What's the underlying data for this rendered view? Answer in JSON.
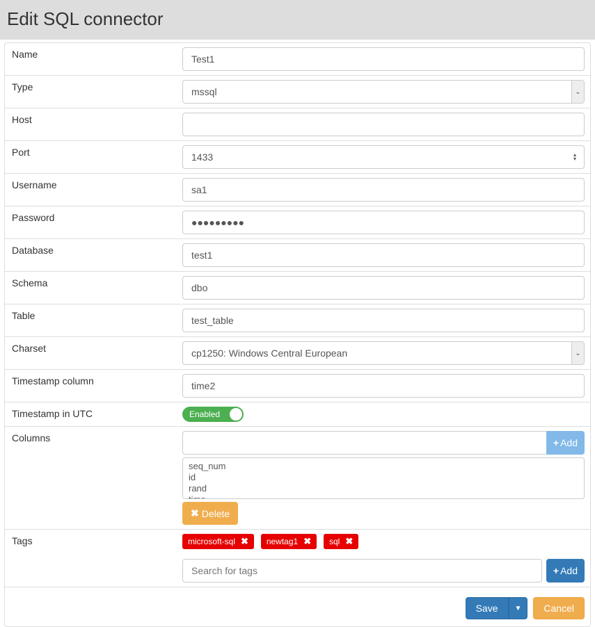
{
  "header": {
    "title": "Edit SQL connector"
  },
  "labels": {
    "name": "Name",
    "type": "Type",
    "host": "Host",
    "port": "Port",
    "username": "Username",
    "password": "Password",
    "database": "Database",
    "schema": "Schema",
    "table": "Table",
    "charset": "Charset",
    "timestamp_column": "Timestamp column",
    "timestamp_utc": "Timestamp in UTC",
    "columns": "Columns",
    "tags": "Tags"
  },
  "values": {
    "name": "Test1",
    "type": "mssql",
    "host": "",
    "port": "1433",
    "username": "sa1",
    "password": "●●●●●●●●●",
    "database": "test1",
    "schema": "dbo",
    "table": "test_table",
    "charset": "cp1250: Windows Central European",
    "timestamp_column": "time2",
    "timestamp_utc_label": "Enabled"
  },
  "columns": {
    "add_label": "Add",
    "delete_label": "Delete",
    "items": [
      "seq_num",
      "id",
      "rand",
      "time"
    ]
  },
  "tags": {
    "items": [
      "microsoft-sql",
      "newtag1",
      "sql"
    ],
    "search_placeholder": "Search for tags",
    "add_label": "Add"
  },
  "footer": {
    "save": "Save",
    "cancel": "Cancel"
  }
}
